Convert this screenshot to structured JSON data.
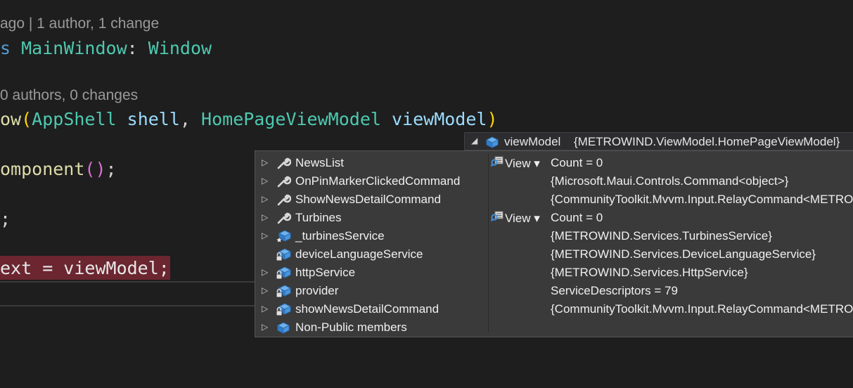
{
  "editor": {
    "codelens_1": "ago | 1 author, 1 change",
    "line_class_kw": "s",
    "line_class_name": "MainWindow",
    "line_class_sep": ":",
    "line_class_base": "Window",
    "codelens_2": "0 authors, 0 changes",
    "ctor_prefix": "ow",
    "ctor_paren_open": "(",
    "ctor_param1_type": "AppShell",
    "ctor_param1_name": "shell",
    "ctor_comma": ",",
    "ctor_param2_type": "HomePageViewModel",
    "ctor_param2_name": "viewModel",
    "ctor_paren_close": ")",
    "init_call": "omponent",
    "init_parens": "()",
    "init_semicolon": ";",
    "assign_line": ";",
    "bp_line_text": "ext = viewModel;"
  },
  "datatip": {
    "header_name": "viewModel",
    "header_value": "{METROWIND.ViewModel.HomePageViewModel}",
    "view_label": "View",
    "rows": [
      {
        "name": "NewsList",
        "value": "Count = 0",
        "icon": "wrench-icon",
        "expandable": true,
        "view": true
      },
      {
        "name": "OnPinMarkerClickedCommand",
        "value": "{Microsoft.Maui.Controls.Command<object>}",
        "icon": "wrench-icon",
        "expandable": true,
        "view": false
      },
      {
        "name": "ShowNewsDetailCommand",
        "value": "{CommunityToolkit.Mvvm.Input.RelayCommand<METRO",
        "icon": "wrench-icon",
        "expandable": true,
        "view": false
      },
      {
        "name": "Turbines",
        "value": "Count = 0",
        "icon": "wrench-icon",
        "expandable": true,
        "view": true
      },
      {
        "name": "_turbinesService",
        "value": "{METROWIND.Services.TurbinesService}",
        "icon": "field-star-icon",
        "expandable": true,
        "view": false
      },
      {
        "name": "deviceLanguageService",
        "value": "{METROWIND.Services.DeviceLanguageService}",
        "icon": "field-lock-icon",
        "expandable": false,
        "view": false
      },
      {
        "name": "httpService",
        "value": "{METROWIND.Services.HttpService}",
        "icon": "field-lock-icon",
        "expandable": true,
        "view": false
      },
      {
        "name": "provider",
        "value": "ServiceDescriptors = 79",
        "icon": "field-lock-icon",
        "expandable": true,
        "view": false
      },
      {
        "name": "showNewsDetailCommand",
        "value": "{CommunityToolkit.Mvvm.Input.RelayCommand<METRO",
        "icon": "field-lock-icon",
        "expandable": true,
        "view": false
      },
      {
        "name": "Non-Public members",
        "value": "",
        "icon": "field-icon",
        "expandable": true,
        "view": false
      }
    ]
  },
  "colors": {
    "background": "#1e1e1e",
    "keyword": "#569cd6",
    "type": "#4ec9b0",
    "method": "#dcdcaa",
    "parameter": "#9cdcfe",
    "breakpoint_line": "#6b2630",
    "datatip_bg": "#3a3a3a",
    "icon_blue": "#3f8fd6"
  }
}
